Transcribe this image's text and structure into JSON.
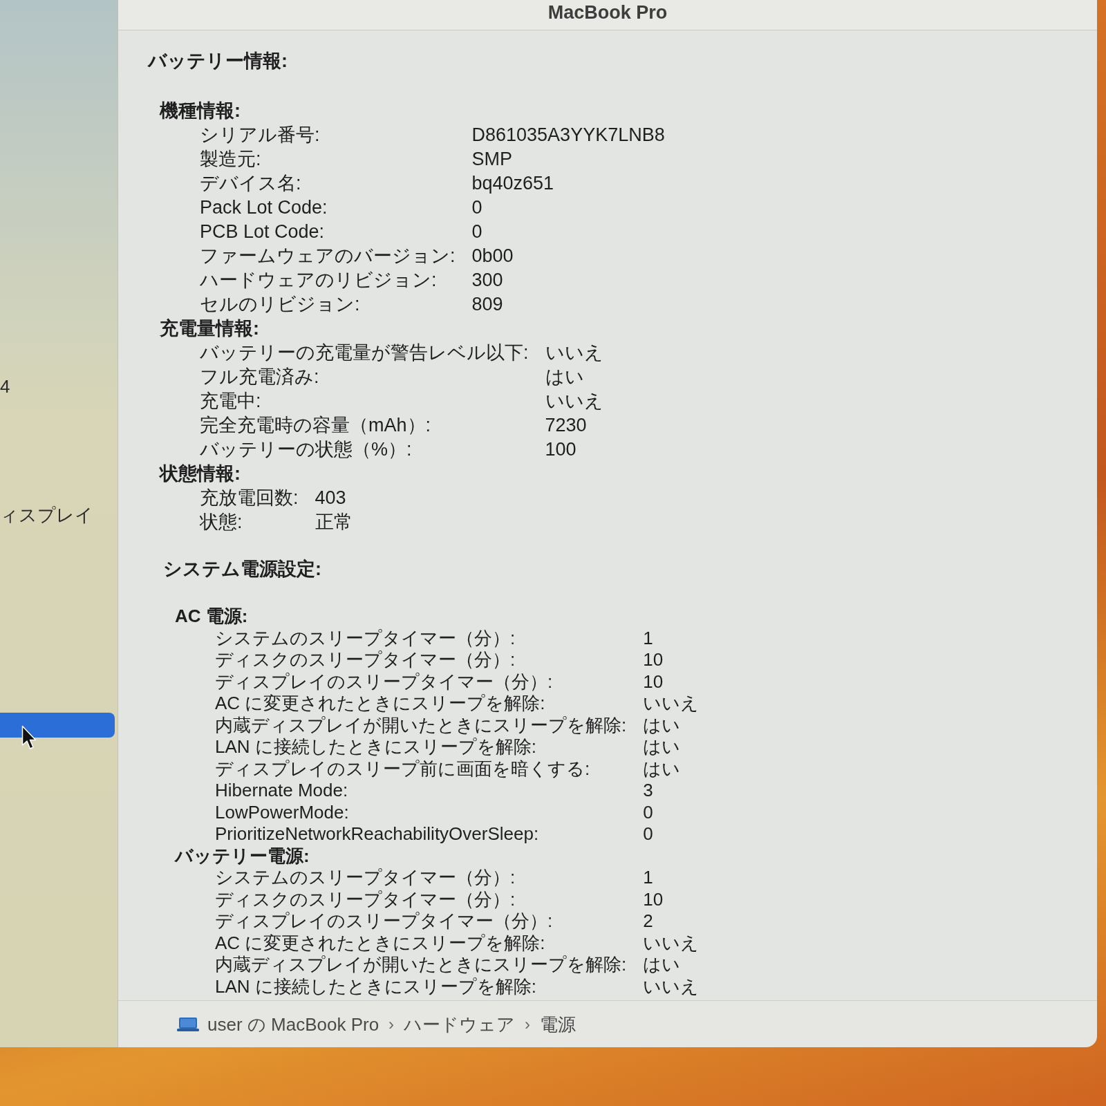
{
  "window": {
    "title": "MacBook Pro"
  },
  "sidebar": {
    "items": [
      {
        "label": "4",
        "selected": false
      },
      {
        "label": "ィスプレイ",
        "selected": false
      },
      {
        "selected": true
      }
    ]
  },
  "sections": [
    {
      "title": "バッテリー情報:",
      "groups": [
        {
          "title": "機種情報:",
          "rows": [
            {
              "label": "シリアル番号:",
              "value": "D861035A3YYK7LNB8"
            },
            {
              "label": "製造元:",
              "value": "SMP"
            },
            {
              "label": "デバイス名:",
              "value": "bq40z651"
            },
            {
              "label": "Pack Lot Code:",
              "value": "0"
            },
            {
              "label": "PCB Lot Code:",
              "value": "0"
            },
            {
              "label": "ファームウェアのバージョン:",
              "value": "0b00"
            },
            {
              "label": "ハードウェアのリビジョン:",
              "value": "300"
            },
            {
              "label": "セルのリビジョン:",
              "value": "809"
            }
          ]
        },
        {
          "title": "充電量情報:",
          "rows": [
            {
              "label": "バッテリーの充電量が警告レベル以下:",
              "value": "いいえ"
            },
            {
              "label": "フル充電済み:",
              "value": "はい"
            },
            {
              "label": "充電中:",
              "value": "いいえ"
            },
            {
              "label": "完全充電時の容量（mAh）:",
              "value": "7230"
            },
            {
              "label": "バッテリーの状態（%）:",
              "value": "100"
            }
          ]
        },
        {
          "title": "状態情報:",
          "rows": [
            {
              "label": "充放電回数:",
              "value": "403"
            },
            {
              "label": "状態:",
              "value": "正常"
            }
          ]
        }
      ]
    },
    {
      "title": "システム電源設定:",
      "groups": [
        {
          "title": "AC 電源:",
          "rows": [
            {
              "label": "システムのスリープタイマー（分）:",
              "value": "1"
            },
            {
              "label": "ディスクのスリープタイマー（分）:",
              "value": "10"
            },
            {
              "label": "ディスプレイのスリープタイマー（分）:",
              "value": "10"
            },
            {
              "label": "AC に変更されたときにスリープを解除:",
              "value": "いいえ"
            },
            {
              "label": "内蔵ディスプレイが開いたときにスリープを解除:",
              "value": "はい"
            },
            {
              "label": "LAN に接続したときにスリープを解除:",
              "value": "はい"
            },
            {
              "label": "ディスプレイのスリープ前に画面を暗くする:",
              "value": "はい"
            },
            {
              "label": "Hibernate Mode:",
              "value": "3"
            },
            {
              "label": "LowPowerMode:",
              "value": "0"
            },
            {
              "label": "PrioritizeNetworkReachabilityOverSleep:",
              "value": "0"
            }
          ]
        },
        {
          "title": "バッテリー電源:",
          "rows": [
            {
              "label": "システムのスリープタイマー（分）:",
              "value": "1"
            },
            {
              "label": "ディスクのスリープタイマー（分）:",
              "value": "10"
            },
            {
              "label": "ディスプレイのスリープタイマー（分）:",
              "value": "2"
            },
            {
              "label": "AC に変更されたときにスリープを解除:",
              "value": "いいえ"
            },
            {
              "label": "内蔵ディスプレイが開いたときにスリープを解除:",
              "value": "はい"
            },
            {
              "label": "LAN に接続したときにスリープを解除:",
              "value": "いいえ"
            }
          ]
        }
      ]
    }
  ],
  "path_bar": {
    "items": [
      {
        "kind": "computer",
        "label": "user の MacBook Pro"
      },
      {
        "kind": "separator",
        "label": "›"
      },
      {
        "kind": "location",
        "label": "ハードウェア"
      },
      {
        "kind": "separator",
        "label": "›"
      },
      {
        "kind": "location",
        "label": "電源"
      }
    ]
  }
}
